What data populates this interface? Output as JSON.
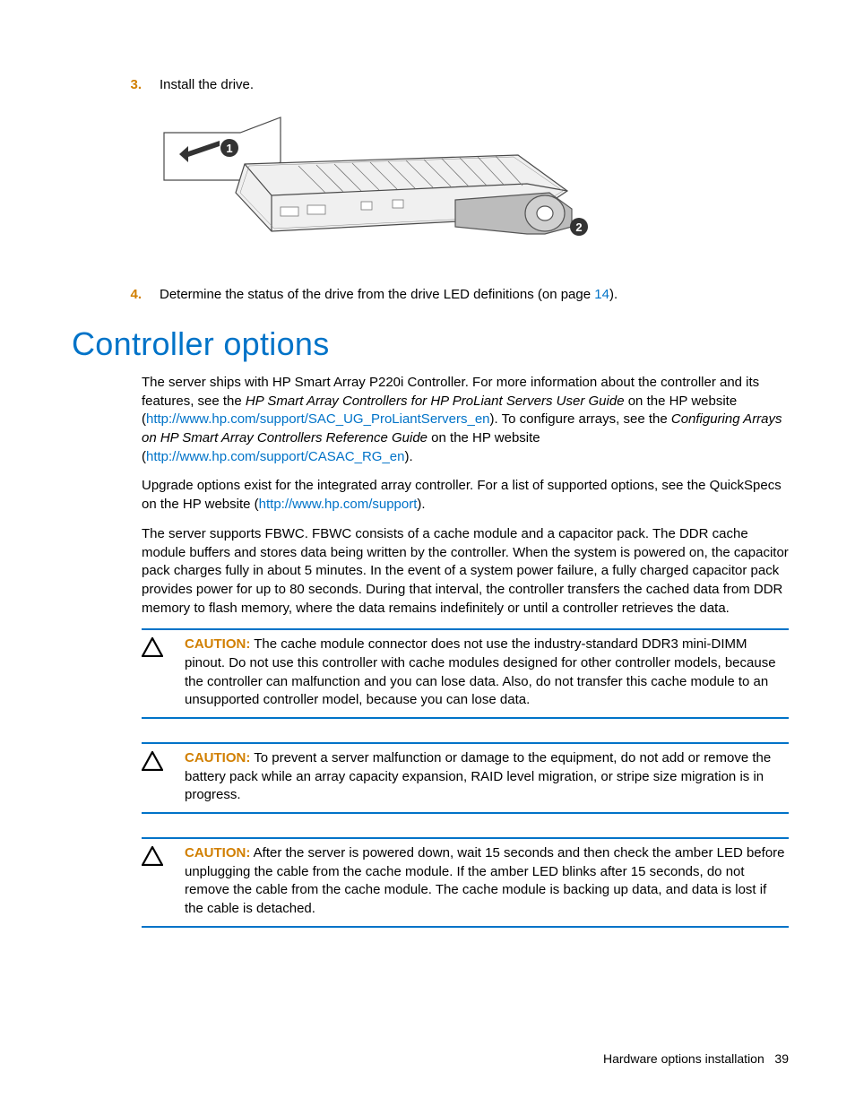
{
  "steps": {
    "s3": {
      "num": "3.",
      "text": "Install the drive."
    },
    "s4": {
      "num": "4.",
      "pre": "Determine the status of the drive from the drive LED definitions (on page ",
      "pagelink": "14",
      "post": ")."
    }
  },
  "section_heading": "Controller options",
  "para1": {
    "t1": "The server ships with HP Smart Array P220i Controller. For more information about the controller and its features, see the ",
    "i1": "HP Smart Array Controllers for HP ProLiant Servers User Guide",
    "t2": " on the HP website (",
    "l1": "http://www.hp.com/support/SAC_UG_ProLiantServers_en",
    "t3": "). To configure arrays, see the ",
    "i2": "Configuring Arrays on HP Smart Array Controllers Reference Guide",
    "t4": " on the HP website (",
    "l2": "http://www.hp.com/support/CASAC_RG_en",
    "t5": ")."
  },
  "para2": {
    "t1": "Upgrade options exist for the integrated array controller. For a list of supported options, see the QuickSpecs on the HP website (",
    "l1": "http://www.hp.com/support",
    "t2": ")."
  },
  "para3": "The server supports FBWC. FBWC consists of a cache module and a capacitor pack. The DDR cache module buffers and stores data being written by the controller. When the system is powered on, the capacitor pack charges fully in about 5 minutes. In the event of a system power failure, a fully charged capacitor pack provides power for up to 80 seconds. During that interval, the controller transfers the cached data from DDR memory to flash memory, where the data remains indefinitely or until a controller retrieves the data.",
  "cautions": {
    "label": "CAUTION:",
    "c1": "  The cache module connector does not use the industry-standard DDR3 mini-DIMM pinout. Do not use this controller with cache modules designed for other controller models, because the controller can malfunction and you can lose data. Also, do not transfer this cache module to an unsupported controller model, because you can lose data.",
    "c2": "  To prevent a server malfunction or damage to the equipment, do not add or remove the battery pack while an array capacity expansion, RAID level migration, or stripe size migration is in progress.",
    "c3": "  After the server is powered down, wait 15 seconds and then check the amber LED before unplugging the cable from the cache module. If the amber LED blinks after 15 seconds, do not remove the cable from the cache module. The cache module is backing up data, and data is lost if the cable is detached."
  },
  "footer": {
    "section": "Hardware options installation",
    "page": "39"
  },
  "icons": {
    "caution": "caution-triangle-icon",
    "illustration": "drive-install-illustration"
  }
}
